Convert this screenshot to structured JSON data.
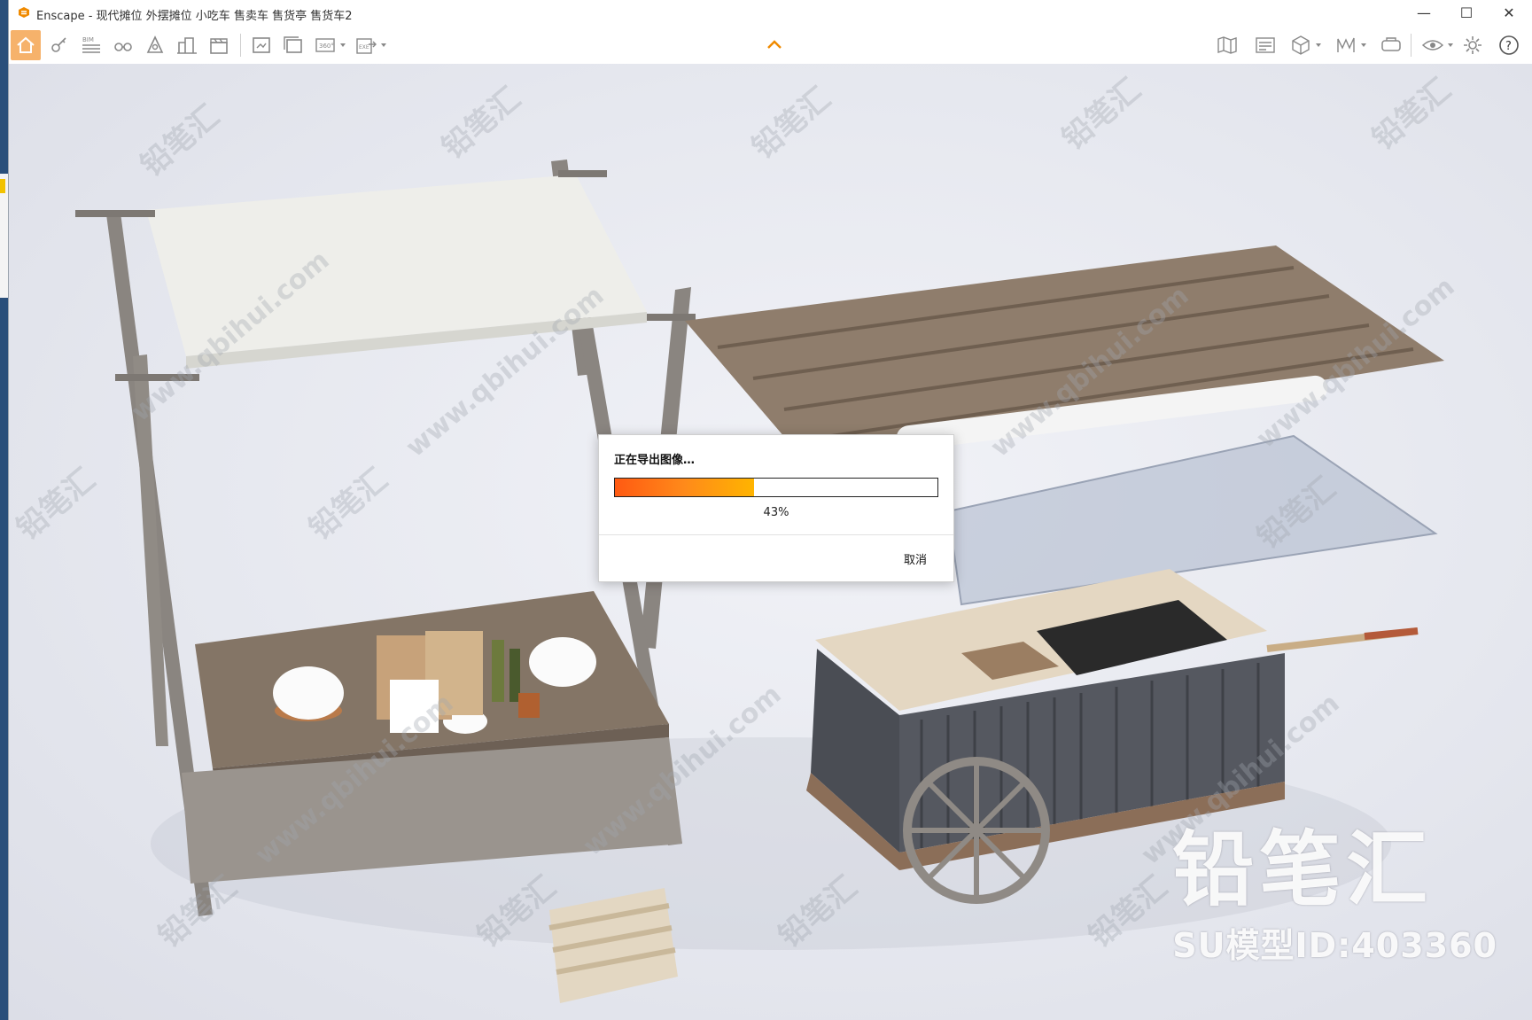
{
  "window": {
    "title": "Enscape - 现代摊位 外摆摊位 小吃车 售卖车 售货亭 售货车2",
    "controls": [
      "—",
      "☐",
      "✕"
    ]
  },
  "toolbar": {
    "left_buttons": [
      {
        "name": "home-icon",
        "tooltip": "Home"
      },
      {
        "name": "key-icon"
      },
      {
        "name": "bim-icon",
        "label": "BIM"
      },
      {
        "name": "binoculars-icon"
      },
      {
        "name": "compass-icon"
      },
      {
        "name": "buildings-icon"
      },
      {
        "name": "clapper-icon"
      },
      {
        "name": "screenshot-icon"
      },
      {
        "name": "batch-render-icon"
      },
      {
        "name": "panorama-360-icon",
        "label": "360°"
      },
      {
        "name": "export-exe-icon",
        "label": "EXE"
      }
    ],
    "right_buttons": [
      {
        "name": "map-icon"
      },
      {
        "name": "asset-library-icon"
      },
      {
        "name": "cube-icon"
      },
      {
        "name": "chart-icon"
      },
      {
        "name": "vr-headset-icon"
      },
      {
        "name": "eye-icon"
      },
      {
        "name": "gear-icon"
      },
      {
        "name": "help-icon",
        "label": "?"
      }
    ]
  },
  "watermark": {
    "repeat_text_1": "铅笔汇",
    "repeat_text_2": "www.qbihui.com",
    "brand_name": "铅笔汇",
    "model_id": "SU模型ID:403360"
  },
  "dialog": {
    "message": "正在导出图像…",
    "progress": 0.43,
    "percent_label": "43%",
    "cancel_label": "取消"
  },
  "colors": {
    "accent": "#ff8a1a",
    "home_highlight": "#f6b26b",
    "progress_start": "#ff5a12",
    "progress_end": "#ffb400"
  }
}
